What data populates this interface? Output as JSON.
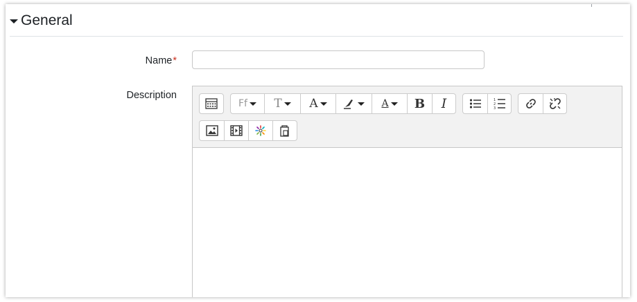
{
  "section": {
    "title": "General"
  },
  "form": {
    "name_label": "Name",
    "required_marker": "*",
    "name_value": "",
    "description_label": "Description"
  },
  "editor": {
    "toolbar_row1": [
      {
        "name": "toolbar-toggle-icon"
      },
      {
        "name": "font-family-icon",
        "glyph": "Ff",
        "dropdown": true
      },
      {
        "name": "font-size-icon",
        "glyph": "T",
        "dropdown": true
      },
      {
        "name": "font-color-icon",
        "glyph": "A",
        "dropdown": true
      },
      {
        "name": "background-color-icon",
        "dropdown": true
      },
      {
        "name": "style-icon",
        "glyph": "A",
        "dropdown": true
      },
      {
        "name": "bold-icon",
        "glyph": "B"
      },
      {
        "name": "italic-icon",
        "glyph": "I"
      },
      {
        "name": "unordered-list-icon"
      },
      {
        "name": "ordered-list-icon"
      },
      {
        "name": "link-icon"
      },
      {
        "name": "unlink-icon"
      }
    ],
    "toolbar_row2": [
      {
        "name": "image-icon"
      },
      {
        "name": "media-icon"
      },
      {
        "name": "h5p-icon"
      },
      {
        "name": "manage-files-icon"
      }
    ],
    "content": ""
  },
  "colors": {
    "required": "#ca3120",
    "border": "#c7c7c7",
    "toolbar_bg": "#f2f2f2"
  }
}
